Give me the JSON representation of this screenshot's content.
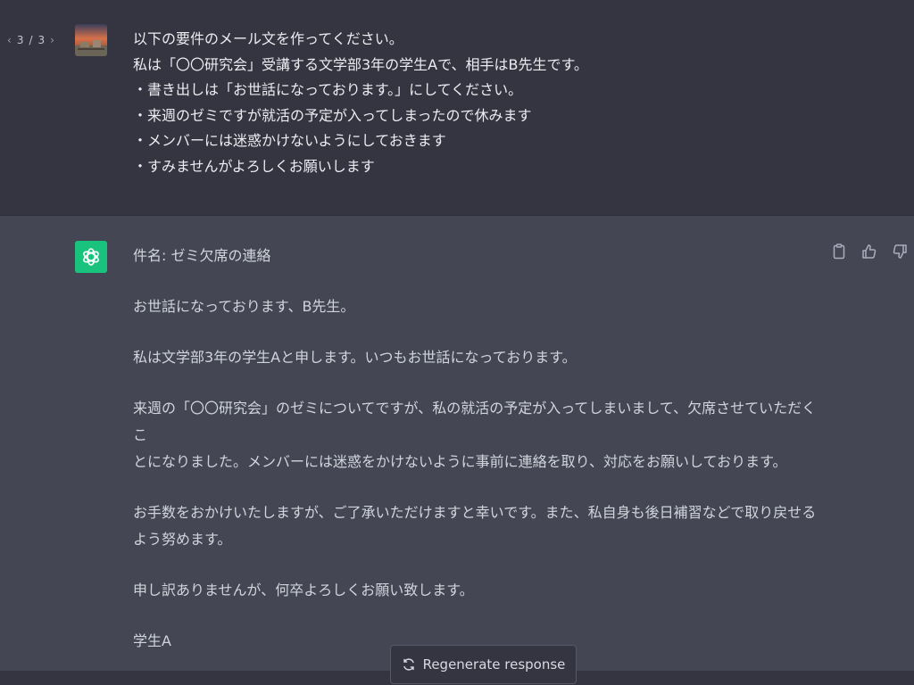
{
  "pager": {
    "current": "3",
    "separator": "/",
    "total": "3",
    "prev_icon": "chevron-left-icon",
    "next_icon": "chevron-right-icon"
  },
  "user": {
    "avatar": "user-avatar-photo",
    "lines": [
      "以下の要件のメール文を作ってください。",
      "私は「〇〇研究会」受講する文学部3年の学生Aで、相手はB先生です。",
      "・書き出しは「お世話になっております。」にしてください。",
      "・来週のゼミですが就活の予定が入ってしまったので休みます",
      "・メンバーには迷惑かけないようにしておきます",
      "・すみませんがよろしくお願いします"
    ]
  },
  "assistant": {
    "avatar": "openai-logo-icon",
    "subject": "件名: ゼミ欠席の連絡",
    "greeting": "お世話になっております、B先生。",
    "intro": "私は文学部3年の学生Aと申します。いつもお世話になっております。",
    "body1_line1": "来週の「〇〇研究会」のゼミについてですが、私の就活の予定が入ってしまいまして、欠席させていただくこ",
    "body1_line2": "とになりました。メンバーには迷惑をかけないように事前に連絡を取り、対応をお願いしております。",
    "body2_line1": "お手数をおかけいたしますが、ご了承いただけますと幸いです。また、私自身も後日補習などで取り戻せる",
    "body2_line2": "よう努めます。",
    "closing": "申し訳ありませんが、何卒よろしくお願い致します。",
    "signature": "学生A",
    "actions": [
      "clipboard-icon",
      "thumbs-up-icon",
      "thumbs-down-icon"
    ]
  },
  "regenerate": {
    "label": "Regenerate response",
    "icon": "refresh-icon"
  },
  "colors": {
    "user_bg": "#343541",
    "assistant_bg": "#444654",
    "bot_avatar": "#19c37d",
    "text_user": "#ececf1",
    "text_assistant": "#d1d5db"
  }
}
